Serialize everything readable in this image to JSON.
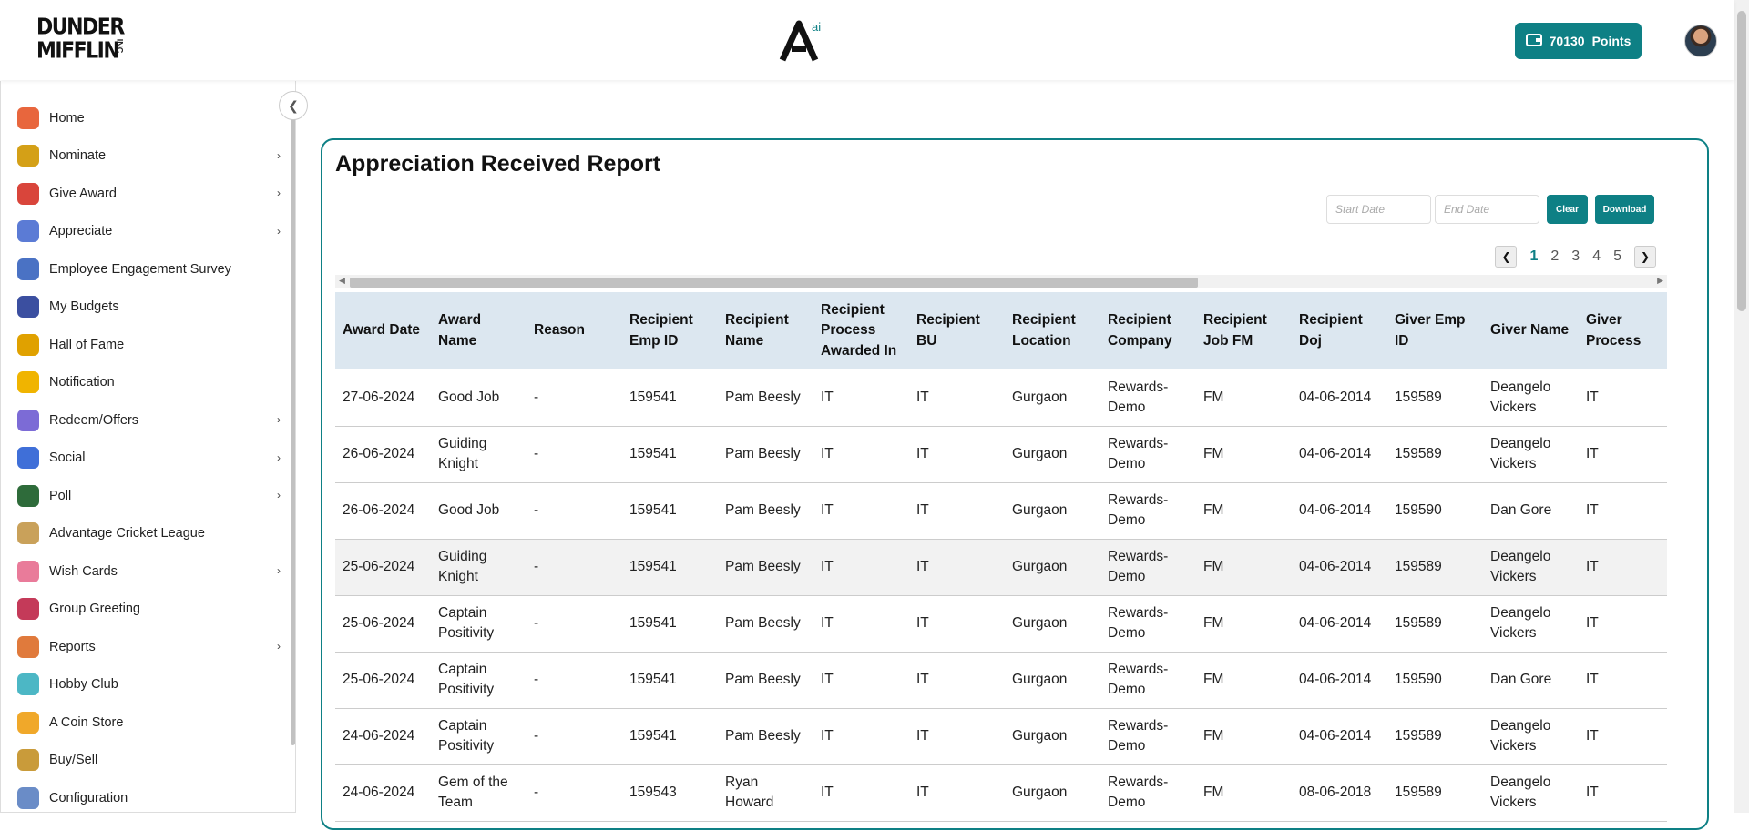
{
  "header": {
    "logo_line1": "DUNDER",
    "logo_line2": "MIFFLIN",
    "logo_inc": "INC",
    "brand_mark_letter": "A",
    "brand_mark_sup": "ai",
    "points_value": "70130",
    "points_label": "Points",
    "accent_color": "#0e8085"
  },
  "sidebar": {
    "items": [
      {
        "label": "Home",
        "icon": "home-icon",
        "chev": ""
      },
      {
        "label": "Nominate",
        "icon": "trophy-icon",
        "chev": "›"
      },
      {
        "label": "Give Award",
        "icon": "gift-icon",
        "chev": "›"
      },
      {
        "label": "Appreciate",
        "icon": "medal-icon",
        "chev": "›"
      },
      {
        "label": "Employee Engagement Survey",
        "icon": "survey-icon",
        "chev": ""
      },
      {
        "label": "My Budgets",
        "icon": "wallet-icon",
        "chev": ""
      },
      {
        "label": "Hall of Fame",
        "icon": "crown-icon",
        "chev": ""
      },
      {
        "label": "Notification",
        "icon": "bell-icon",
        "chev": ""
      },
      {
        "label": "Redeem/Offers",
        "icon": "coupon-icon",
        "chev": "›"
      },
      {
        "label": "Social",
        "icon": "chat-icon",
        "chev": "›"
      },
      {
        "label": "Poll",
        "icon": "poll-icon",
        "chev": "›"
      },
      {
        "label": "Advantage Cricket League",
        "icon": "cricket-icon",
        "chev": ""
      },
      {
        "label": "Wish Cards",
        "icon": "party-icon",
        "chev": "›"
      },
      {
        "label": "Group Greeting",
        "icon": "envelope-icon",
        "chev": ""
      },
      {
        "label": "Reports",
        "icon": "clipboard-icon",
        "chev": "›"
      },
      {
        "label": "Hobby Club",
        "icon": "map-icon",
        "chev": ""
      },
      {
        "label": "A Coin Store",
        "icon": "coin-icon",
        "chev": ""
      },
      {
        "label": "Buy/Sell",
        "icon": "shopping-bag-icon",
        "chev": ""
      },
      {
        "label": "Configuration",
        "icon": "config-icon",
        "chev": ""
      }
    ]
  },
  "report": {
    "title": "Appreciation Received Report",
    "start_date_placeholder": "Start Date",
    "end_date_placeholder": "End Date",
    "clear_label": "Clear",
    "download_label": "Download",
    "pages": [
      "1",
      "2",
      "3",
      "4",
      "5"
    ],
    "active_page": "1",
    "columns": [
      "Award Date",
      "Award Name",
      "Reason",
      "Recipient Emp ID",
      "Recipient Name",
      "Recipient Process Awarded In",
      "Recipient BU",
      "Recipient Location",
      "Recipient Company",
      "Recipient Job FM",
      "Recipient Doj",
      "Giver Emp ID",
      "Giver Name",
      "Giver Process"
    ],
    "rows": [
      [
        "27-06-2024",
        "Good Job",
        "-",
        "159541",
        "Pam Beesly",
        "IT",
        "IT",
        "Gurgaon",
        "Rewards-Demo",
        "FM",
        "04-06-2014",
        "159589",
        "Deangelo Vickers",
        "IT"
      ],
      [
        "26-06-2024",
        "Guiding Knight",
        "-",
        "159541",
        "Pam Beesly",
        "IT",
        "IT",
        "Gurgaon",
        "Rewards-Demo",
        "FM",
        "04-06-2014",
        "159589",
        "Deangelo Vickers",
        "IT"
      ],
      [
        "26-06-2024",
        "Good Job",
        "-",
        "159541",
        "Pam Beesly",
        "IT",
        "IT",
        "Gurgaon",
        "Rewards-Demo",
        "FM",
        "04-06-2014",
        "159590",
        "Dan Gore",
        "IT"
      ],
      [
        "25-06-2024",
        "Guiding Knight",
        "-",
        "159541",
        "Pam Beesly",
        "IT",
        "IT",
        "Gurgaon",
        "Rewards-Demo",
        "FM",
        "04-06-2014",
        "159589",
        "Deangelo Vickers",
        "IT"
      ],
      [
        "25-06-2024",
        "Captain Positivity",
        "-",
        "159541",
        "Pam Beesly",
        "IT",
        "IT",
        "Gurgaon",
        "Rewards-Demo",
        "FM",
        "04-06-2014",
        "159589",
        "Deangelo Vickers",
        "IT"
      ],
      [
        "25-06-2024",
        "Captain Positivity",
        "-",
        "159541",
        "Pam Beesly",
        "IT",
        "IT",
        "Gurgaon",
        "Rewards-Demo",
        "FM",
        "04-06-2014",
        "159590",
        "Dan Gore",
        "IT"
      ],
      [
        "24-06-2024",
        "Captain Positivity",
        "-",
        "159541",
        "Pam Beesly",
        "IT",
        "IT",
        "Gurgaon",
        "Rewards-Demo",
        "FM",
        "04-06-2014",
        "159589",
        "Deangelo Vickers",
        "IT"
      ],
      [
        "24-06-2024",
        "Gem of the Team",
        "-",
        "159543",
        "Ryan Howard",
        "IT",
        "IT",
        "Gurgaon",
        "Rewards-Demo",
        "FM",
        "08-06-2018",
        "159589",
        "Deangelo Vickers",
        "IT"
      ]
    ]
  }
}
